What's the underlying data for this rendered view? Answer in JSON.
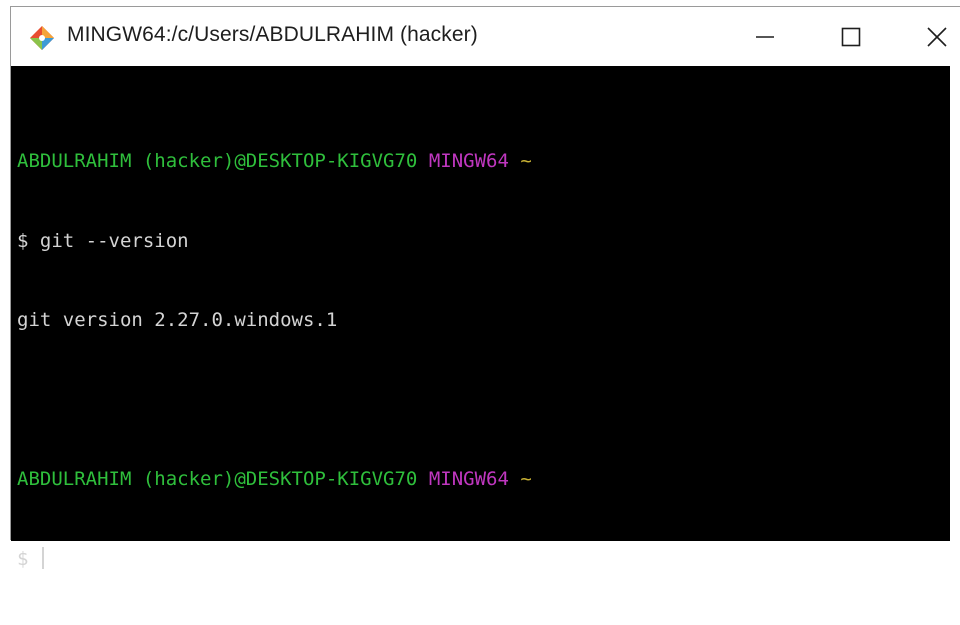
{
  "window": {
    "title": "MINGW64:/c/Users/ABDULRAHIM (hacker)",
    "app_icon": "git-diamond-icon",
    "controls": {
      "minimize_icon": "minimize-icon",
      "maximize_icon": "maximize-icon",
      "close_icon": "close-icon"
    }
  },
  "terminal": {
    "colors": {
      "background": "#000000",
      "user_host": "#2fbf3c",
      "env": "#c037c0",
      "path": "#c9b234",
      "text": "#d4d4d4"
    },
    "block1": {
      "user_host": "ABDULRAHIM (hacker)@DESKTOP-KIGVG70",
      "env": "MINGW64",
      "path": "~",
      "prompt_symbol": "$",
      "command": "git --version",
      "output": "git version 2.27.0.windows.1"
    },
    "block2": {
      "user_host": "ABDULRAHIM (hacker)@DESKTOP-KIGVG70",
      "env": "MINGW64",
      "path": "~",
      "prompt_symbol": "$",
      "command": ""
    }
  }
}
